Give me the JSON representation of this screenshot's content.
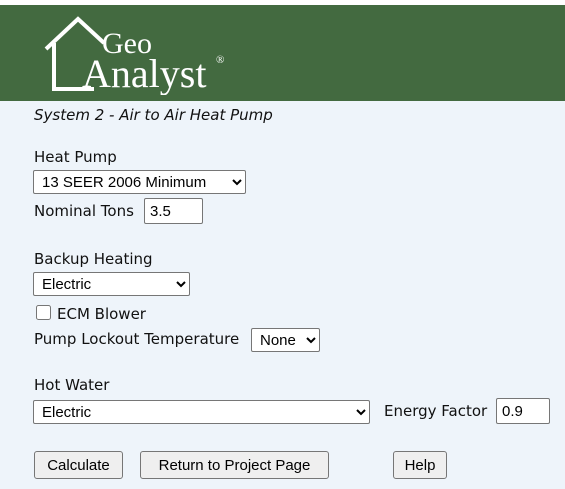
{
  "header": {
    "logo_text_top": "Geo",
    "logo_text_bottom": "Analyst",
    "logo_mark": "®"
  },
  "system_title": "System 2 - Air to Air Heat Pump",
  "heat_pump": {
    "label": "Heat Pump",
    "selected": "13 SEER 2006 Minimum",
    "nominal_tons_label": "Nominal Tons",
    "nominal_tons_value": "3.5"
  },
  "backup_heating": {
    "label": "Backup Heating",
    "selected": "Electric",
    "ecm_blower_label": "ECM Blower",
    "ecm_blower_checked": false,
    "lockout_label": "Pump Lockout Temperature",
    "lockout_selected": "None"
  },
  "hot_water": {
    "label": "Hot Water",
    "selected": "Electric",
    "energy_factor_label": "Energy Factor",
    "energy_factor_value": "0.9"
  },
  "buttons": {
    "calculate": "Calculate",
    "return": "Return to Project Page",
    "help": "Help"
  },
  "colors": {
    "header_bg": "#436a40",
    "page_bg": "#eef4fa"
  },
  "icons": [
    "house-logo-icon",
    "chevron-down-icon"
  ]
}
